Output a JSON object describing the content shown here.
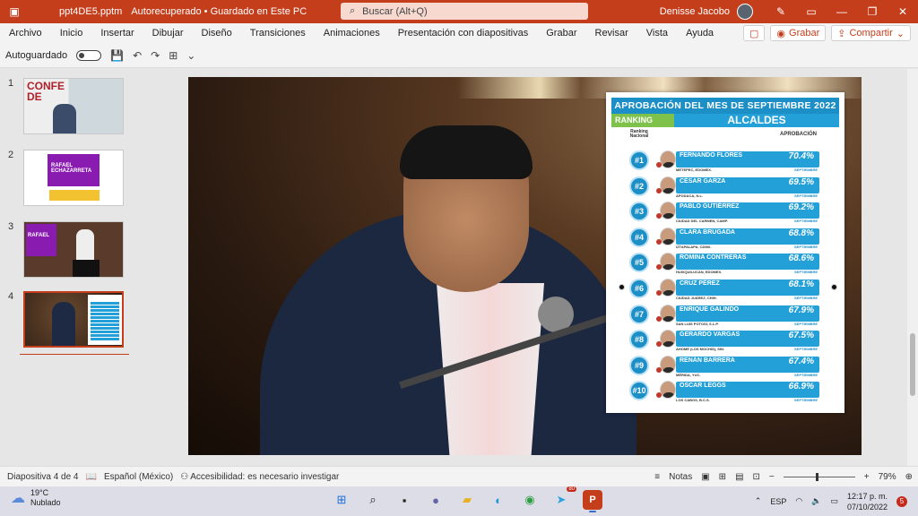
{
  "window": {
    "filename": "ppt4DE5.pptm",
    "status": "Autorecuperado • Guardado en Este PC",
    "search_placeholder": "Buscar (Alt+Q)",
    "user": "Denisse Jacobo",
    "accent_color": "#c43e1c"
  },
  "menu": {
    "items": [
      "Archivo",
      "Inicio",
      "Insertar",
      "Dibujar",
      "Diseño",
      "Transiciones",
      "Animaciones",
      "Presentación con diapositivas",
      "Grabar",
      "Revisar",
      "Vista",
      "Ayuda"
    ],
    "record_label": "Grabar",
    "share_label": "Compartir"
  },
  "qat": {
    "autosave_label": "Autoguardado"
  },
  "thumbnails": [
    {
      "num": "1",
      "text": "CONFE DE"
    },
    {
      "num": "2",
      "text": "RAFAEL ECHAZARRETA"
    },
    {
      "num": "3",
      "text": "RAFAEL"
    },
    {
      "num": "4",
      "text": ""
    }
  ],
  "slide": {
    "card": {
      "title": "APROBACIÓN DEL MES DE SEPTIEMBRE 2022",
      "ranking_label": "RANKING",
      "category": "ALCALDES",
      "col_rank": "Ranking Nacional",
      "col_approval": "APROBACIÓN",
      "month_tag": "SEPTIEMBRE",
      "rows": [
        {
          "rank": "#1",
          "name": "FERNANDO FLORES",
          "place": "METEPEC, EDOMEX.",
          "pct": "70.4%"
        },
        {
          "rank": "#2",
          "name": "CÉSAR GARZA",
          "place": "APODACA, N.L.",
          "pct": "69.5%"
        },
        {
          "rank": "#3",
          "name": "PABLO GUTIÉRREZ",
          "place": "CIUDAD DEL CARMEN, CAMP.",
          "pct": "69.2%"
        },
        {
          "rank": "#4",
          "name": "CLARA BRUGADA",
          "place": "IZTAPALAPA, CDMX.",
          "pct": "68.8%"
        },
        {
          "rank": "#5",
          "name": "ROMINA CONTRERAS",
          "place": "HUIXQUILUCAN, EDOMEX.",
          "pct": "68.6%"
        },
        {
          "rank": "#6",
          "name": "CRUZ PÉREZ",
          "place": "CIUDAD JUÁREZ, CHIH.",
          "pct": "68.1%"
        },
        {
          "rank": "#7",
          "name": "ENRIQUE GALINDO",
          "place": "SAN LUIS POTOSÍ, S.L.P.",
          "pct": "67.9%"
        },
        {
          "rank": "#8",
          "name": "GERARDO VARGAS",
          "place": "AHOME (LOS MOCHIS), SIN.",
          "pct": "67.5%"
        },
        {
          "rank": "#9",
          "name": "RENÁN BARRERA",
          "place": "MÉRIDA, YUC.",
          "pct": "67.4%"
        },
        {
          "rank": "#10",
          "name": "OSCAR LEGGS",
          "place": "LOS CABOS, B.C.S.",
          "pct": "66.9%"
        }
      ]
    }
  },
  "status": {
    "slide_indicator": "Diapositiva 4 de 4",
    "language": "Español (México)",
    "accessibility": "Accesibilidad: es necesario investigar",
    "notes": "Notas",
    "zoom": "79%"
  },
  "taskbar": {
    "temp": "19°C",
    "weather": "Nublado",
    "lang": "ESP",
    "time": "12:17 p. m.",
    "date": "07/10/2022",
    "notif_count": "5",
    "badge_count": "80"
  }
}
